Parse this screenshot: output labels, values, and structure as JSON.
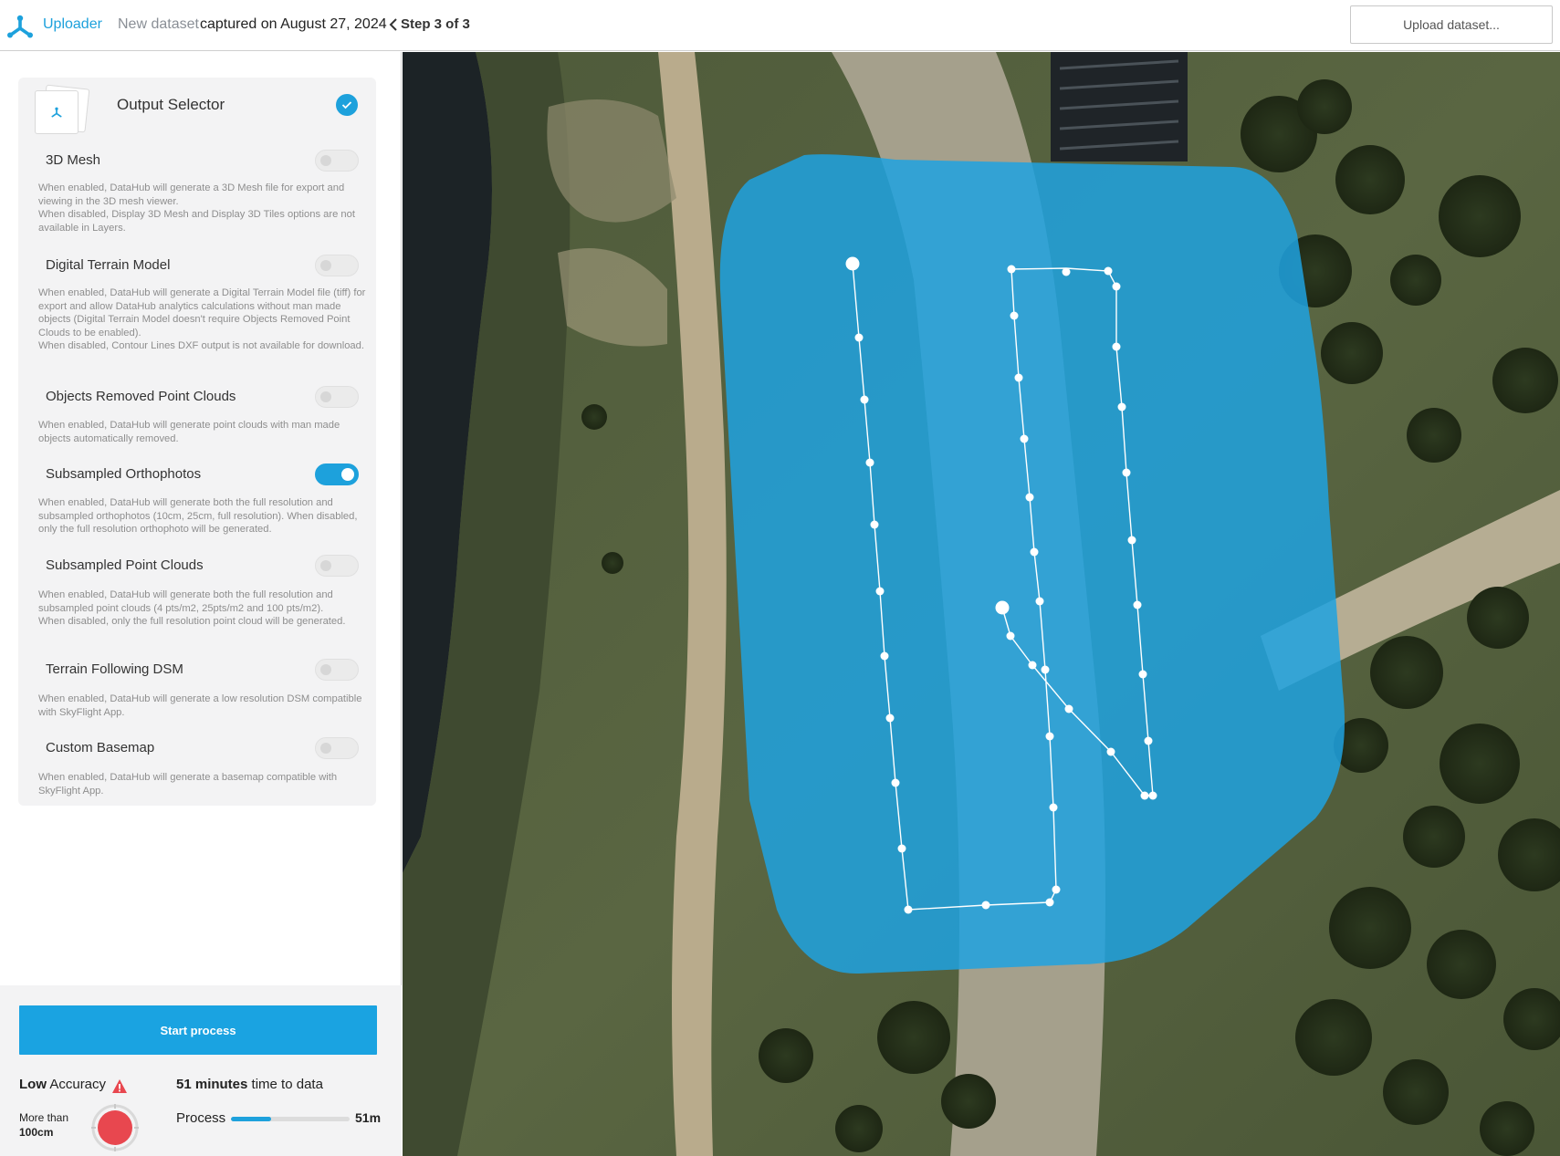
{
  "header": {
    "app_name": "Uploader",
    "dataset_label": "New dataset",
    "captured_text": "captured on August 27, 2024",
    "step_label": "Step 3 of 3",
    "upload_button": "Upload dataset..."
  },
  "colors": {
    "accent": "#1da1dc",
    "warning": "#e8474f",
    "area_overlay": "#1fa2e0"
  },
  "output_selector": {
    "title": "Output Selector",
    "checked": true,
    "options": [
      {
        "title": "3D Mesh",
        "enabled": false,
        "description": "When enabled, DataHub will generate a 3D Mesh file for export and viewing in the 3D mesh viewer.\nWhen disabled, Display 3D Mesh and Display 3D Tiles options are not available in Layers."
      },
      {
        "title": "Digital Terrain Model",
        "enabled": false,
        "description": "When enabled, DataHub will generate a Digital Terrain Model file (tiff) for export and allow DataHub analytics calculations without man made objects (Digital Terrain Model doesn't require Objects Removed Point Clouds to be enabled).\nWhen disabled, Contour Lines DXF output is not available for download."
      },
      {
        "title": "Objects Removed Point Clouds",
        "enabled": false,
        "description": "When enabled, DataHub will generate point clouds with man made objects automatically removed."
      },
      {
        "title": "Subsampled Orthophotos",
        "enabled": true,
        "description": "When enabled, DataHub will generate both the full resolution and subsampled orthophotos (10cm, 25cm, full resolution). When disabled, only the full resolution orthophoto will be generated."
      },
      {
        "title": "Subsampled Point Clouds",
        "enabled": false,
        "description": "When enabled, DataHub will generate both the full resolution and subsampled point clouds (4 pts/m2, 25pts/m2 and 100 pts/m2).\nWhen disabled, only the full resolution point cloud will be generated."
      },
      {
        "title": "Terrain Following DSM",
        "enabled": false,
        "description": "When enabled, DataHub will generate a low resolution DSM compatible with SkyFlight App."
      },
      {
        "title": "Custom Basemap",
        "enabled": false,
        "description": "When enabled, DataHub will generate a basemap compatible with SkyFlight App."
      }
    ]
  },
  "footer": {
    "start_button": "Start process",
    "accuracy_level": "Low",
    "accuracy_word": "Accuracy",
    "more_than_text": "More than",
    "more_than_value": "100cm",
    "time_value": "51 minutes",
    "time_suffix": "time to data",
    "process_label": "Process",
    "process_value": "51m",
    "process_fraction": 0.34
  },
  "map": {
    "type": "satellite",
    "flight_path_icon": "waypoint-path-icon"
  }
}
